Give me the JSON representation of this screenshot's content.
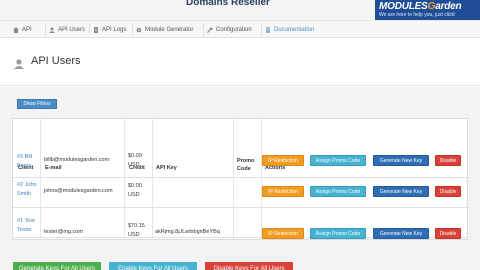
{
  "header": {
    "title": "Domains Reseller",
    "logo_brand_a": "M",
    "logo_brand_b": "ODULES",
    "logo_brand_c": "G",
    "logo_brand_d": "arden",
    "logo_tagline": "We are here to help you, just click!"
  },
  "nav": {
    "items": [
      {
        "label": "API",
        "icon": "home-icon"
      },
      {
        "label": "API Users",
        "icon": "users-icon"
      },
      {
        "label": "API Logs",
        "icon": "logs-icon"
      },
      {
        "label": "Module Generator",
        "icon": "gear-icon"
      },
      {
        "label": "Configuration",
        "icon": "wrench-icon"
      },
      {
        "label": "Documentation",
        "icon": "doc-icon"
      }
    ]
  },
  "page": {
    "title": "API Users",
    "filter_button": "Show Filters"
  },
  "table": {
    "headers": [
      "Client",
      "E-mail",
      "Credit",
      "API Key",
      "Promo Code",
      "Actions"
    ],
    "rows": [
      {
        "client": "#3 Bill Bears",
        "email": "billb@modulesgarden.com",
        "credit": "$0.00 USD",
        "api_key": "",
        "promo": ""
      },
      {
        "client": "#2 John Smith",
        "email": "johns@modulesgarden.com",
        "credit": "$0.00 USD",
        "api_key": "",
        "promo": ""
      },
      {
        "client": "#1 Test Tester",
        "email": "tester@mg.com",
        "credit": "$70.15 USD",
        "api_key": "akRjmg.8jJLwfsbgnBeYBq",
        "promo": ""
      }
    ],
    "actions": {
      "ip": "IP Restriction",
      "promo": "Assign Promo Code",
      "generate": "Generate New Key",
      "disable": "Disable"
    }
  },
  "bottom": {
    "generate_all": "Generate Keys For All Users",
    "enable_all": "Enable Keys For All Users",
    "disable_all": "Disable Keys For All Users"
  },
  "colors": {
    "primary": "#4a8cc6",
    "orange": "#f39c22",
    "teal": "#45b3d1",
    "blue": "#2f6db5",
    "red": "#d9423a",
    "green": "#4cae4c"
  }
}
